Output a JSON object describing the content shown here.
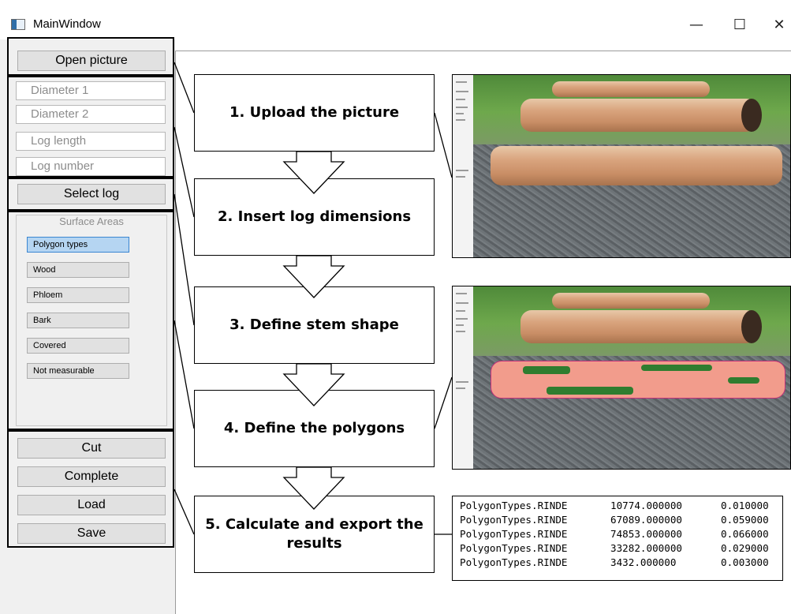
{
  "window": {
    "title": "MainWindow",
    "minimize_glyph": "—",
    "maximize_glyph": "☐",
    "close_glyph": "✕"
  },
  "left_panel": {
    "open_picture": "Open picture",
    "inputs": [
      {
        "placeholder": "Diameter 1"
      },
      {
        "placeholder": "Diameter 2"
      },
      {
        "placeholder": "Log length"
      },
      {
        "placeholder": "Log number"
      }
    ],
    "select_log": "Select log",
    "surface_areas": {
      "title": "Surface Areas",
      "buttons": [
        "Polygon types",
        "Wood",
        "Phloem",
        "Bark",
        "Covered",
        "Not measurable"
      ],
      "active": "Polygon types"
    },
    "actions": [
      "Cut",
      "Complete",
      "Load",
      "Save"
    ]
  },
  "steps": [
    "1. Upload the picture",
    "2. Insert log dimensions",
    "3. Define stem shape",
    "4. Define the polygons",
    "5. Calculate and export the results"
  ],
  "results": {
    "rows": [
      [
        "PolygonTypes.RINDE",
        "10774.000000",
        "0.010000"
      ],
      [
        "PolygonTypes.RINDE",
        "67089.000000",
        "0.059000"
      ],
      [
        "PolygonTypes.RINDE",
        "74853.000000",
        "0.066000"
      ],
      [
        "PolygonTypes.RINDE",
        "33282.000000",
        "0.029000"
      ],
      [
        "PolygonTypes.RINDE",
        "3432.000000",
        "0.003000"
      ]
    ]
  },
  "colors": {
    "panel_bg": "#f0f0f0",
    "button_bg": "#e1e1e1",
    "active_button_bg": "#b5d5f2",
    "polygon_fill": "#f29c8c",
    "polygon_green": "#2f7d2f"
  }
}
